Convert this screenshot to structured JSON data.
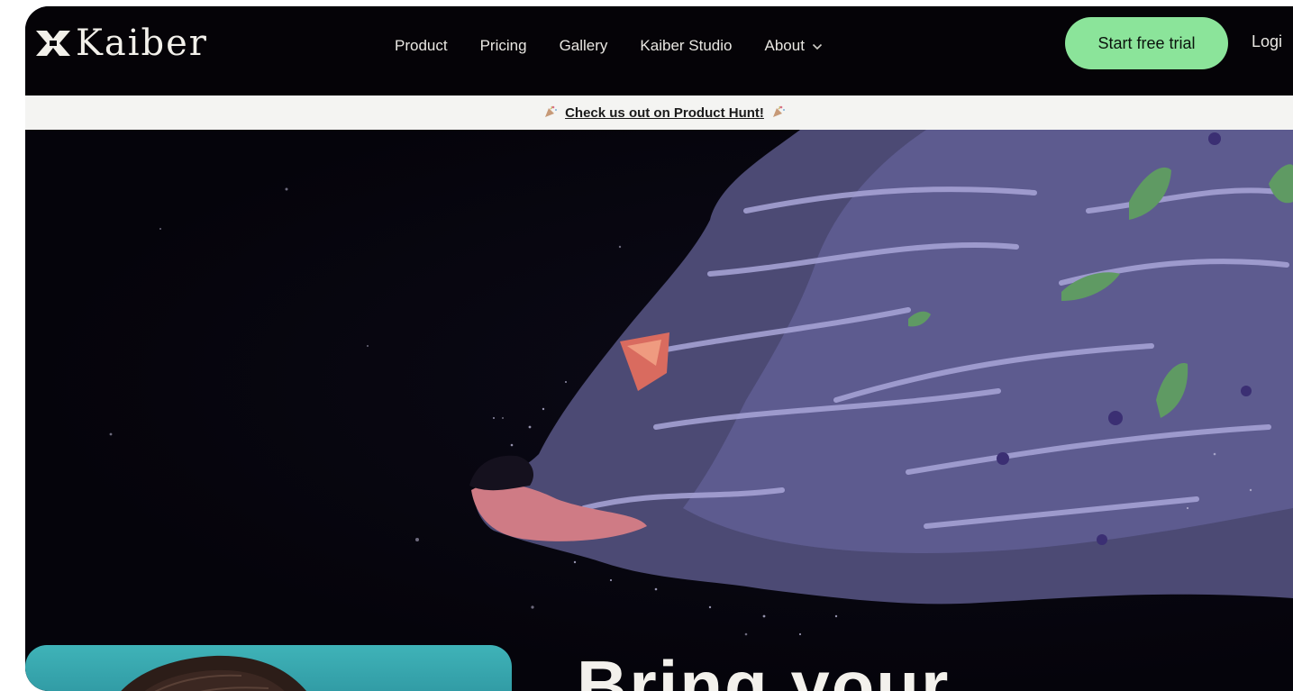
{
  "nav": {
    "brand": "Kaiber",
    "links": [
      "Product",
      "Pricing",
      "Gallery",
      "Kaiber Studio",
      "About"
    ],
    "cta_label": "Start free trial",
    "login_label": "Logi"
  },
  "announcement": {
    "link_text": "Check us out on Product Hunt!"
  },
  "hero": {
    "heading": "Bring your"
  },
  "colors": {
    "cta": "#8be49a",
    "background": "#05040b",
    "announcement_bar": "#f4f4f2"
  },
  "icons": [
    "kaiber-logo-icon",
    "chevron-down-icon",
    "party-popper-icon"
  ]
}
